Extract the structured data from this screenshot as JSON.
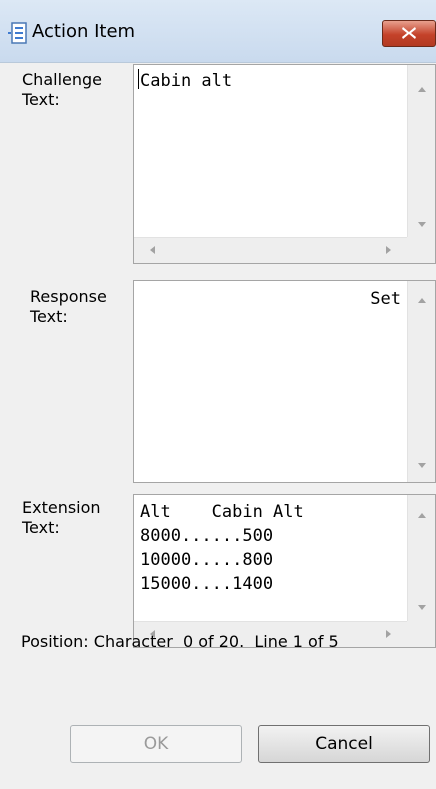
{
  "window": {
    "title": "Action Item",
    "icon": "list-icon",
    "close_icon": "close-icon"
  },
  "challenge": {
    "label_line1": "Challenge",
    "label_line2": "Text:",
    "text": "Cabin alt"
  },
  "response": {
    "label_line1": "Response",
    "label_line2": "Text:",
    "text": "Set"
  },
  "extension": {
    "label_line1": "Extension",
    "label_line2": "Text:",
    "lines": [
      "Alt    Cabin Alt",
      "8000......500",
      "10000.....800",
      "15000....1400"
    ]
  },
  "status": {
    "text": "Position: Character  0 of 20.  Line 1 of 5"
  },
  "buttons": {
    "ok_label": "OK",
    "cancel_label": "Cancel"
  },
  "colors": {
    "close_button": "#c4422a",
    "window_bg": "#f0f0f0"
  }
}
